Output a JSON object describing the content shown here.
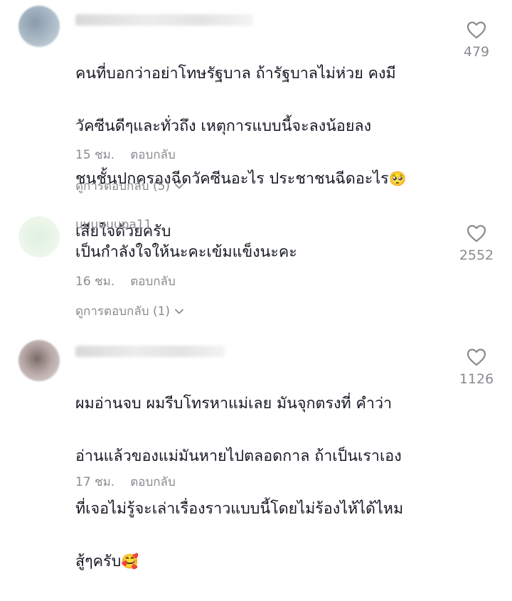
{
  "comments": [
    {
      "username": "",
      "text": "คนที่บอกว่าอย่าโทษรัฐบาล ถ้ารัฐบาลไม่ห่วย คงมีวัคซีนดีๆและทั่วถึง เหตุการแบบนี้จะลงน้อยลง ชนชั้นปกครองฉีดวัคซีนอะไร ประชาชนฉีดอะไร",
      "emoji": "🥺",
      "text_tail": "เสียใจด้วยครับ",
      "time": "15 ชม.",
      "reply_label": "ตอบกลับ",
      "view_replies": "ดูการตอบกลับ (5)",
      "likes": "479",
      "like_icon": "heart-outline-icon"
    },
    {
      "username": "uuuuuupa11",
      "text": "เป็นกำลังใจให้นะคะเข้มแข็งนะคะ",
      "time": "16 ชม.",
      "reply_label": "ตอบกลับ",
      "view_replies": "ดูการตอบกลับ (1)",
      "likes": "2552",
      "like_icon": "heart-outline-icon"
    },
    {
      "username": "",
      "text": "ผมอ่านจบ ผมรีบโทรหาแม่เลย มันจุกตรงที่ คำว่า อ่านแล้วของแม่มันหายไปตลอดกาล ถ้าเป็นเราเอง ที่เจอไม่รู้จะเล่าเรื่องราวแบบนี้โดยไม่ร้องไห้ได้ไหม สู้ๆครับ",
      "emoji": "🥰",
      "time": "17 ชม.",
      "reply_label": "ตอบกลับ",
      "likes": "1126",
      "like_icon": "heart-outline-icon"
    }
  ]
}
